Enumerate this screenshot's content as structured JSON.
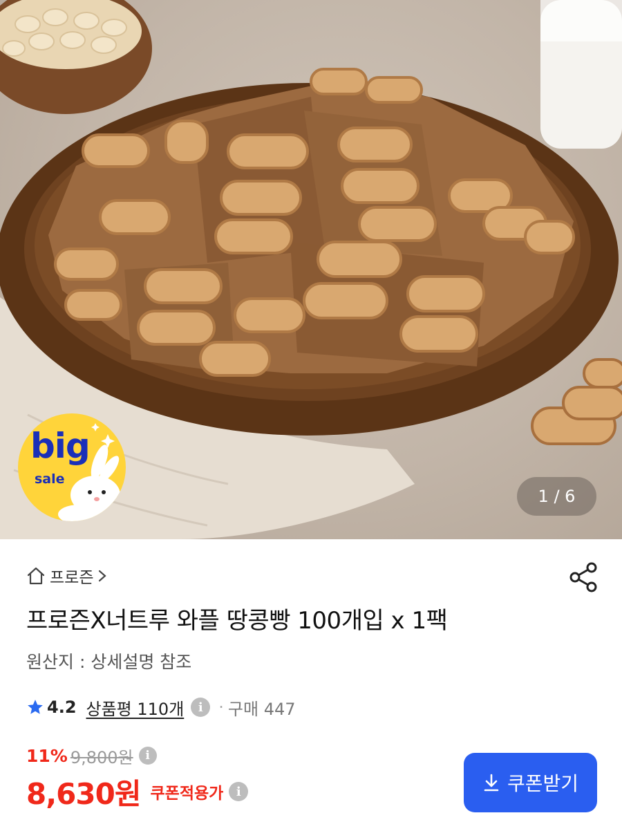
{
  "hero": {
    "badge": {
      "big": "big",
      "sale": "sale"
    },
    "counter": "1 / 6"
  },
  "breadcrumb": {
    "label": "프로즌",
    "icon": "home-icon"
  },
  "product": {
    "title": "프로즌X너트루 와플 땅콩빵 100개입 x 1팩",
    "origin": "원산지 : 상세설명 참조"
  },
  "rating": {
    "score": "4.2",
    "review_text": "상품평 110개",
    "purchase_text": "구매 447",
    "dot": "·"
  },
  "price": {
    "discount_rate": "11%",
    "original_price": "9,800원",
    "final_price": "8,630원",
    "coupon_label": "쿠폰적용가"
  },
  "coupon_button": {
    "label": "쿠폰받기",
    "color": "#2a5ef0"
  },
  "colors": {
    "accent_red": "#f0281a",
    "badge_yellow": "#ffd43a",
    "badge_blue": "#1a2fb8"
  }
}
